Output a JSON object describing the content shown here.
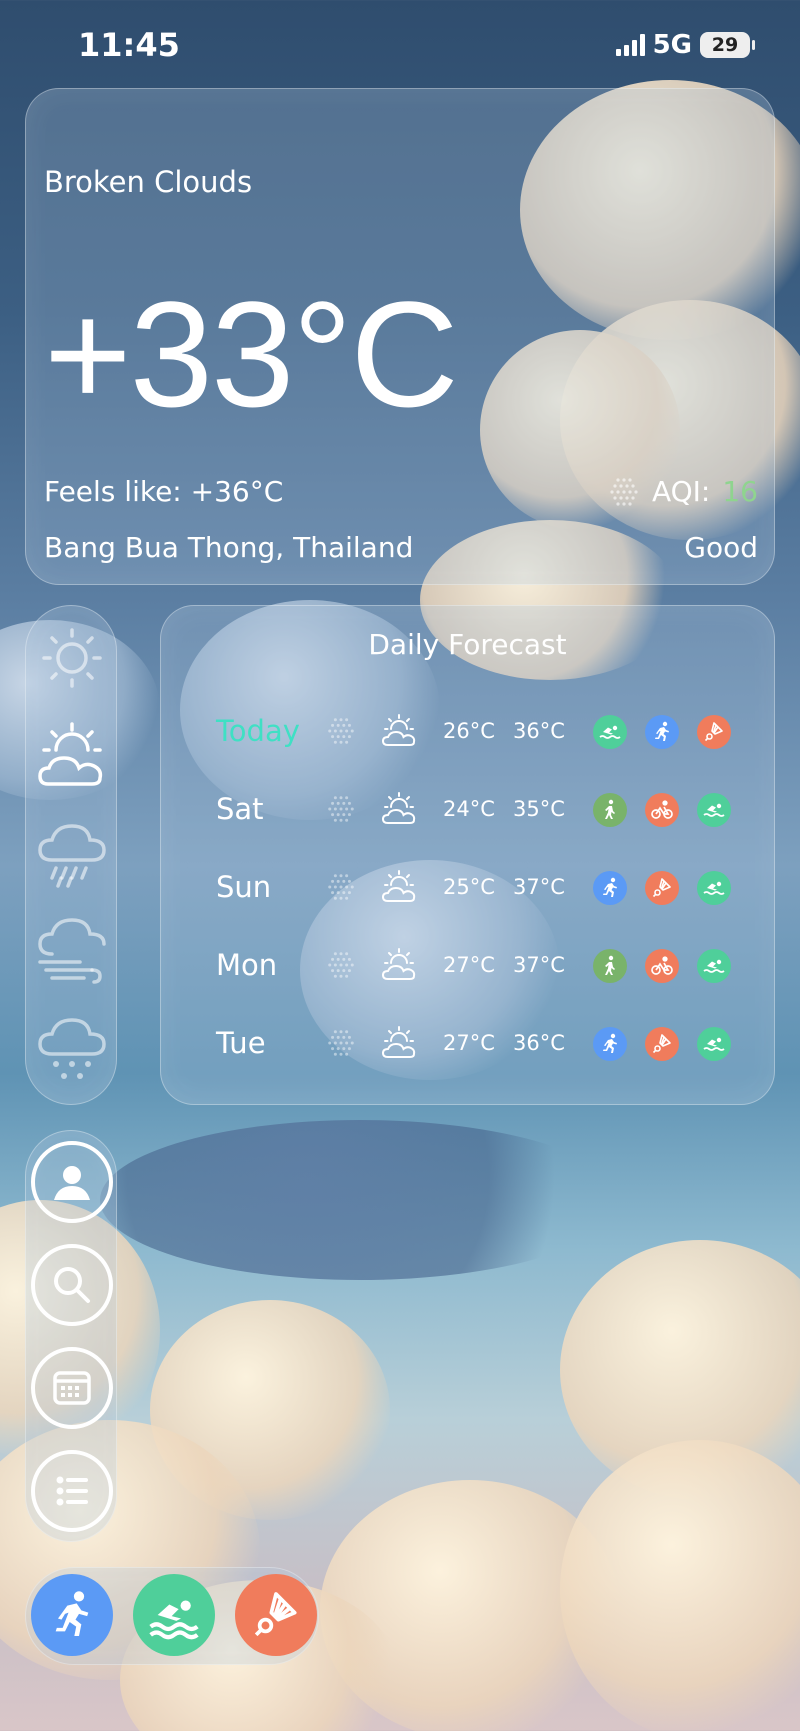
{
  "status_bar": {
    "time": "11:45",
    "network": "5G",
    "battery": "29"
  },
  "current": {
    "condition": "Broken Clouds",
    "temperature": "+33°C",
    "feels_like": "Feels like: +36°C",
    "location": "Bang Bua Thong, Thailand",
    "aqi_label": "AQI:",
    "aqi_value": "16",
    "aqi_status": "Good",
    "aqi_color": "#8fd48f"
  },
  "weather_sidebar": [
    "sun-icon",
    "partly-cloudy-icon",
    "rain-icon",
    "wind-icon",
    "snow-icon"
  ],
  "forecast": {
    "title": "Daily Forecast",
    "days": [
      {
        "day": "Today",
        "min": "26°C",
        "max": "36°C",
        "icon": "partly-cloudy-icon",
        "activities": [
          "swim",
          "run",
          "badminton"
        ]
      },
      {
        "day": "Sat",
        "min": "24°C",
        "max": "35°C",
        "icon": "partly-cloudy-icon",
        "activities": [
          "walk",
          "cycle",
          "swim"
        ]
      },
      {
        "day": "Sun",
        "min": "25°C",
        "max": "37°C",
        "icon": "partly-cloudy-icon",
        "activities": [
          "run",
          "badminton",
          "swim"
        ]
      },
      {
        "day": "Mon",
        "min": "27°C",
        "max": "37°C",
        "icon": "partly-cloudy-icon",
        "activities": [
          "walk",
          "cycle",
          "swim"
        ]
      },
      {
        "day": "Tue",
        "min": "27°C",
        "max": "36°C",
        "icon": "partly-cloudy-icon",
        "activities": [
          "run",
          "badminton",
          "swim"
        ]
      }
    ]
  },
  "nav": [
    "profile-icon",
    "search-icon",
    "calendar-icon",
    "list-icon"
  ],
  "dock": [
    "run-icon",
    "swim-icon",
    "badminton-icon"
  ],
  "colors": {
    "accent_today": "#3fe0c4",
    "run": "#5b9af5",
    "swim": "#4fcf9a",
    "badminton": "#f07c5c",
    "walk": "#79b36a"
  }
}
